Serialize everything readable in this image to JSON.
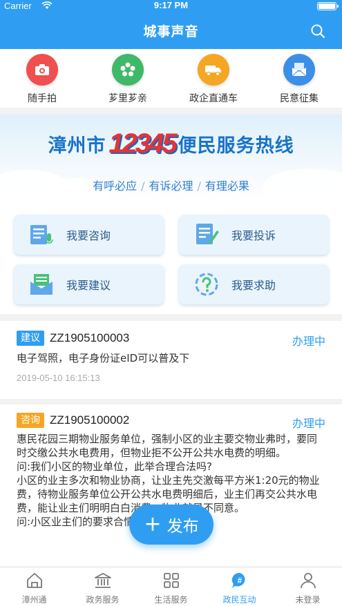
{
  "status_bar": {
    "carrier": "Carrier",
    "time": "9:17 PM"
  },
  "header": {
    "title": "城事声音"
  },
  "shortcuts": [
    {
      "label": "随手拍",
      "icon": "camera-icon",
      "color": "#ef4f4f"
    },
    {
      "label": "芗里芗亲",
      "icon": "flower-icon",
      "color": "#3fb86a"
    },
    {
      "label": "政企直通车",
      "icon": "truck-icon",
      "color": "#f5a623"
    },
    {
      "label": "民意征集",
      "icon": "mail-icon",
      "color": "#3c8fe6"
    }
  ],
  "banner": {
    "city": "漳州市",
    "hotline_number": "12345",
    "service_name": "便民服务热线",
    "slogans": [
      "有呼必应",
      "有诉必理",
      "有理必果"
    ]
  },
  "services": [
    {
      "label": "我要咨询",
      "icon": "consult-icon"
    },
    {
      "label": "我要投诉",
      "icon": "complaint-icon"
    },
    {
      "label": "我要建议",
      "icon": "suggest-icon"
    },
    {
      "label": "我要求助",
      "icon": "help-icon"
    }
  ],
  "items": [
    {
      "tag": "建议",
      "tag_color": "#2f9ef2",
      "code": "ZZ1905100003",
      "status": "办理中",
      "content": "电子驾照，电子身份证eID可以普及下",
      "date": "2019-05-10 16:15:13"
    },
    {
      "tag": "咨询",
      "tag_color": "#f5a623",
      "code": "ZZ1905100002",
      "status": "办理中",
      "content": "惠民花园三期物业服务单位，强制小区的业主要交物业弗时，要同时交缴公共水电费用，但物业拒不公开公共水电费的明细。\n问:我们小区的物业单位，此举合理合法吗?\n小区的业主多次和物业协商，让业主先交激每平方米1:20元的物业费，待物业服务单位公开公共水电费明细后，业主们再交公共水电费，能让业主们明明白白消费。物业就是不同意。\n问:小区业主们的要求合情合理合法吗?",
      "date": ""
    }
  ],
  "fab": {
    "label": "发布"
  },
  "tabs": [
    {
      "label": "漳州通",
      "icon": "home-icon",
      "active": false
    },
    {
      "label": "政务服务",
      "icon": "government-icon",
      "active": false
    },
    {
      "label": "生活服务",
      "icon": "grid-icon",
      "active": false
    },
    {
      "label": "政民互动",
      "icon": "chat-hashtag-icon",
      "active": true
    },
    {
      "label": "未登录",
      "icon": "user-icon",
      "active": false
    }
  ]
}
